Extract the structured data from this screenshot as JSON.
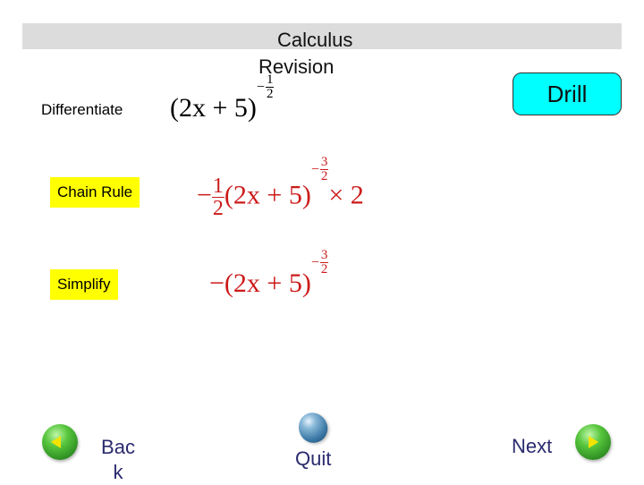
{
  "header": {
    "title_line1": "Calculus",
    "title_line2": "Revision"
  },
  "buttons": {
    "drill": "Drill"
  },
  "steps": [
    {
      "label": "Differentiate",
      "expression": {
        "base": "(2x + 5)",
        "exponent_sign": "−",
        "exponent_num": "1",
        "exponent_den": "2"
      }
    },
    {
      "label": "Chain Rule",
      "expression": {
        "prefix_sign": "−",
        "coef_num": "1",
        "coef_den": "2",
        "base": "(2x + 5)",
        "exponent_sign": "−",
        "exponent_num": "3",
        "exponent_den": "2",
        "suffix": "× 2"
      }
    },
    {
      "label": "Simplify",
      "expression": {
        "base": "−(2x + 5)",
        "exponent_sign": "−",
        "exponent_num": "3",
        "exponent_den": "2"
      }
    }
  ],
  "nav": {
    "back_line1": "Bac",
    "back_line2": "k",
    "quit": "Quit",
    "next": "Next"
  },
  "colors": {
    "title_bar": "#dcdcdc",
    "highlight": "#ffff00",
    "drill_button": "#00ffff",
    "math_result": "#cc1a1a",
    "nav_text": "#2a2a6e"
  }
}
